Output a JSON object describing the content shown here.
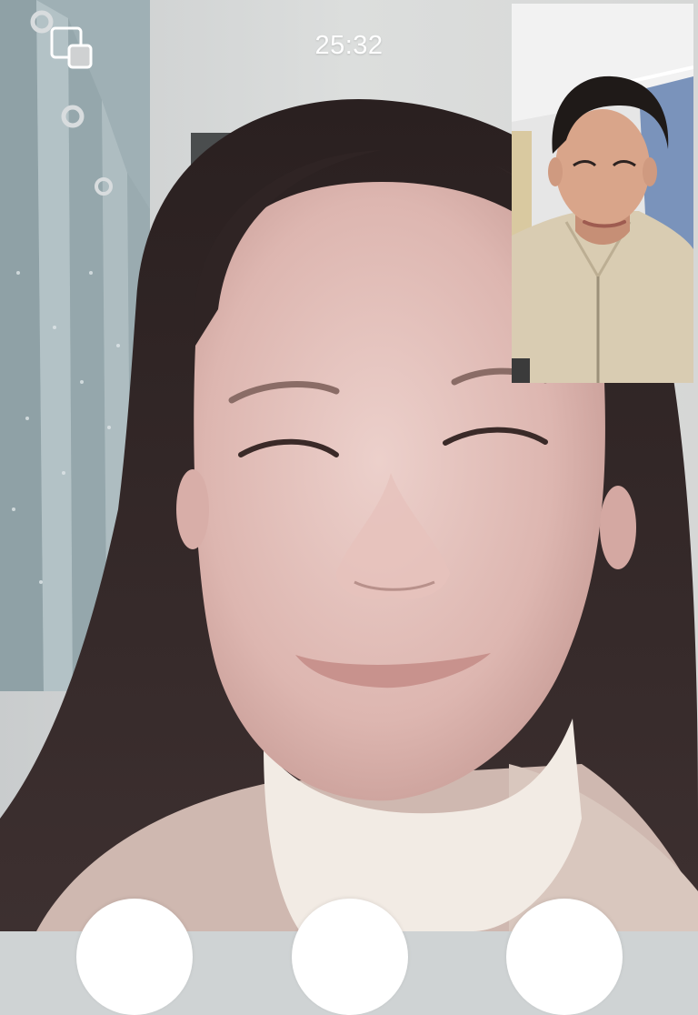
{
  "call": {
    "timer": "25:32"
  },
  "icons": {
    "pip_toggle": "picture-in-picture-icon"
  },
  "colors": {
    "overlay_text": "#ffffff",
    "control_button": "#ffffff"
  }
}
